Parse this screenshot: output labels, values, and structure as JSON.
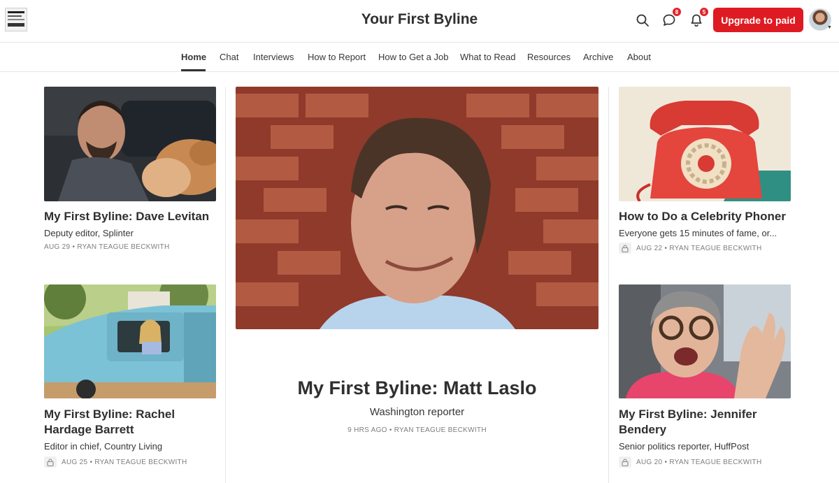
{
  "header": {
    "site_title": "Your First Byline",
    "chat_badge": "8",
    "notif_badge": "5",
    "upgrade_label": "Upgrade to paid",
    "icons": [
      "search-icon",
      "chat-icon",
      "bell-icon"
    ]
  },
  "nav": {
    "items": [
      {
        "label": "Home"
      },
      {
        "label": "Chat"
      },
      {
        "label": "Interviews"
      },
      {
        "label": "How to Report"
      },
      {
        "label": "How to Get a Job"
      },
      {
        "label": "What to Read"
      },
      {
        "label": "Resources"
      },
      {
        "label": "Archive"
      },
      {
        "label": "About"
      }
    ]
  },
  "posts": {
    "dave": {
      "title": "My First Byline: Dave Levitan",
      "subtitle": "Deputy editor, Splinter",
      "meta": "AUG 29 • RYAN TEAGUE BECKWITH"
    },
    "rachel": {
      "title": "My First Byline: Rachel Hardage Barrett",
      "subtitle": "Editor in chief, Country Living",
      "meta": "AUG 25 • RYAN TEAGUE BECKWITH"
    },
    "featured": {
      "title": "My First Byline: Matt Laslo",
      "subtitle": "Washington reporter",
      "meta": "9 HRS AGO • RYAN TEAGUE BECKWITH"
    },
    "phoner": {
      "title": "How to Do a Celebrity Phoner",
      "subtitle": "Everyone gets 15 minutes of fame, or...",
      "meta": "AUG 22 • RYAN TEAGUE BECKWITH"
    },
    "jennifer": {
      "title": "My First Byline: Jennifer Bendery",
      "subtitle": "Senior politics reporter, HuffPost",
      "meta": "AUG 20 • RYAN TEAGUE BECKWITH"
    }
  },
  "colors": {
    "accent": "#de1b22",
    "text": "#363737",
    "meta": "#7d7d7d"
  }
}
